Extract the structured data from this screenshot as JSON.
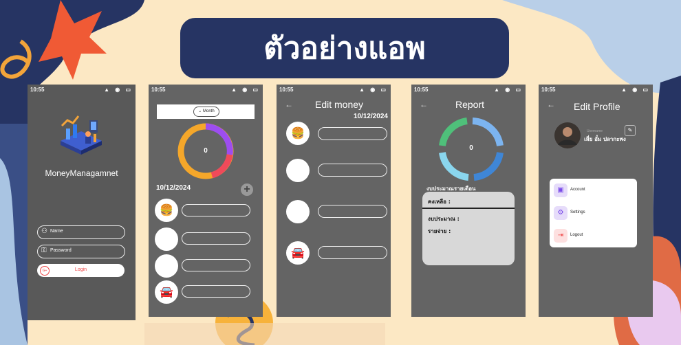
{
  "banner": {
    "title": "ตัวอย่างแอพ"
  },
  "status_time": "10:55",
  "status_icons": "▲ ◉ ▭",
  "login": {
    "app_name": "MoneyManagamnet",
    "name_placeholder": "Name",
    "password_placeholder": "Password",
    "login_label": "Login",
    "google_label": "G+"
  },
  "home": {
    "period_label": "Month",
    "donut_value": "0",
    "date": "10/12/2024",
    "add_label": "+"
  },
  "edit_money": {
    "title": "Edit money",
    "date": "10/12/2024",
    "back": "←"
  },
  "report": {
    "title": "Report",
    "back": "←",
    "donut_value": "0",
    "budget_heading": "งบประมาณรายเดือน",
    "remaining_label": "คงเหลือ :",
    "budget_label": "งบประมาณ :",
    "expense_label": "รายจ่าย :"
  },
  "profile": {
    "title": "Edit Profile",
    "back": "←",
    "username_caption": "Username",
    "username": "เสี่ย อั๋ม ปลากะพง",
    "menu": [
      {
        "label": "Account",
        "icon": "wallet-icon"
      },
      {
        "label": "Settings",
        "icon": "gear-icon"
      },
      {
        "label": "Logout",
        "icon": "logout-icon"
      }
    ]
  },
  "colors": {
    "banner": "#263463",
    "background": "#fce8c4",
    "phone": "#646464"
  }
}
